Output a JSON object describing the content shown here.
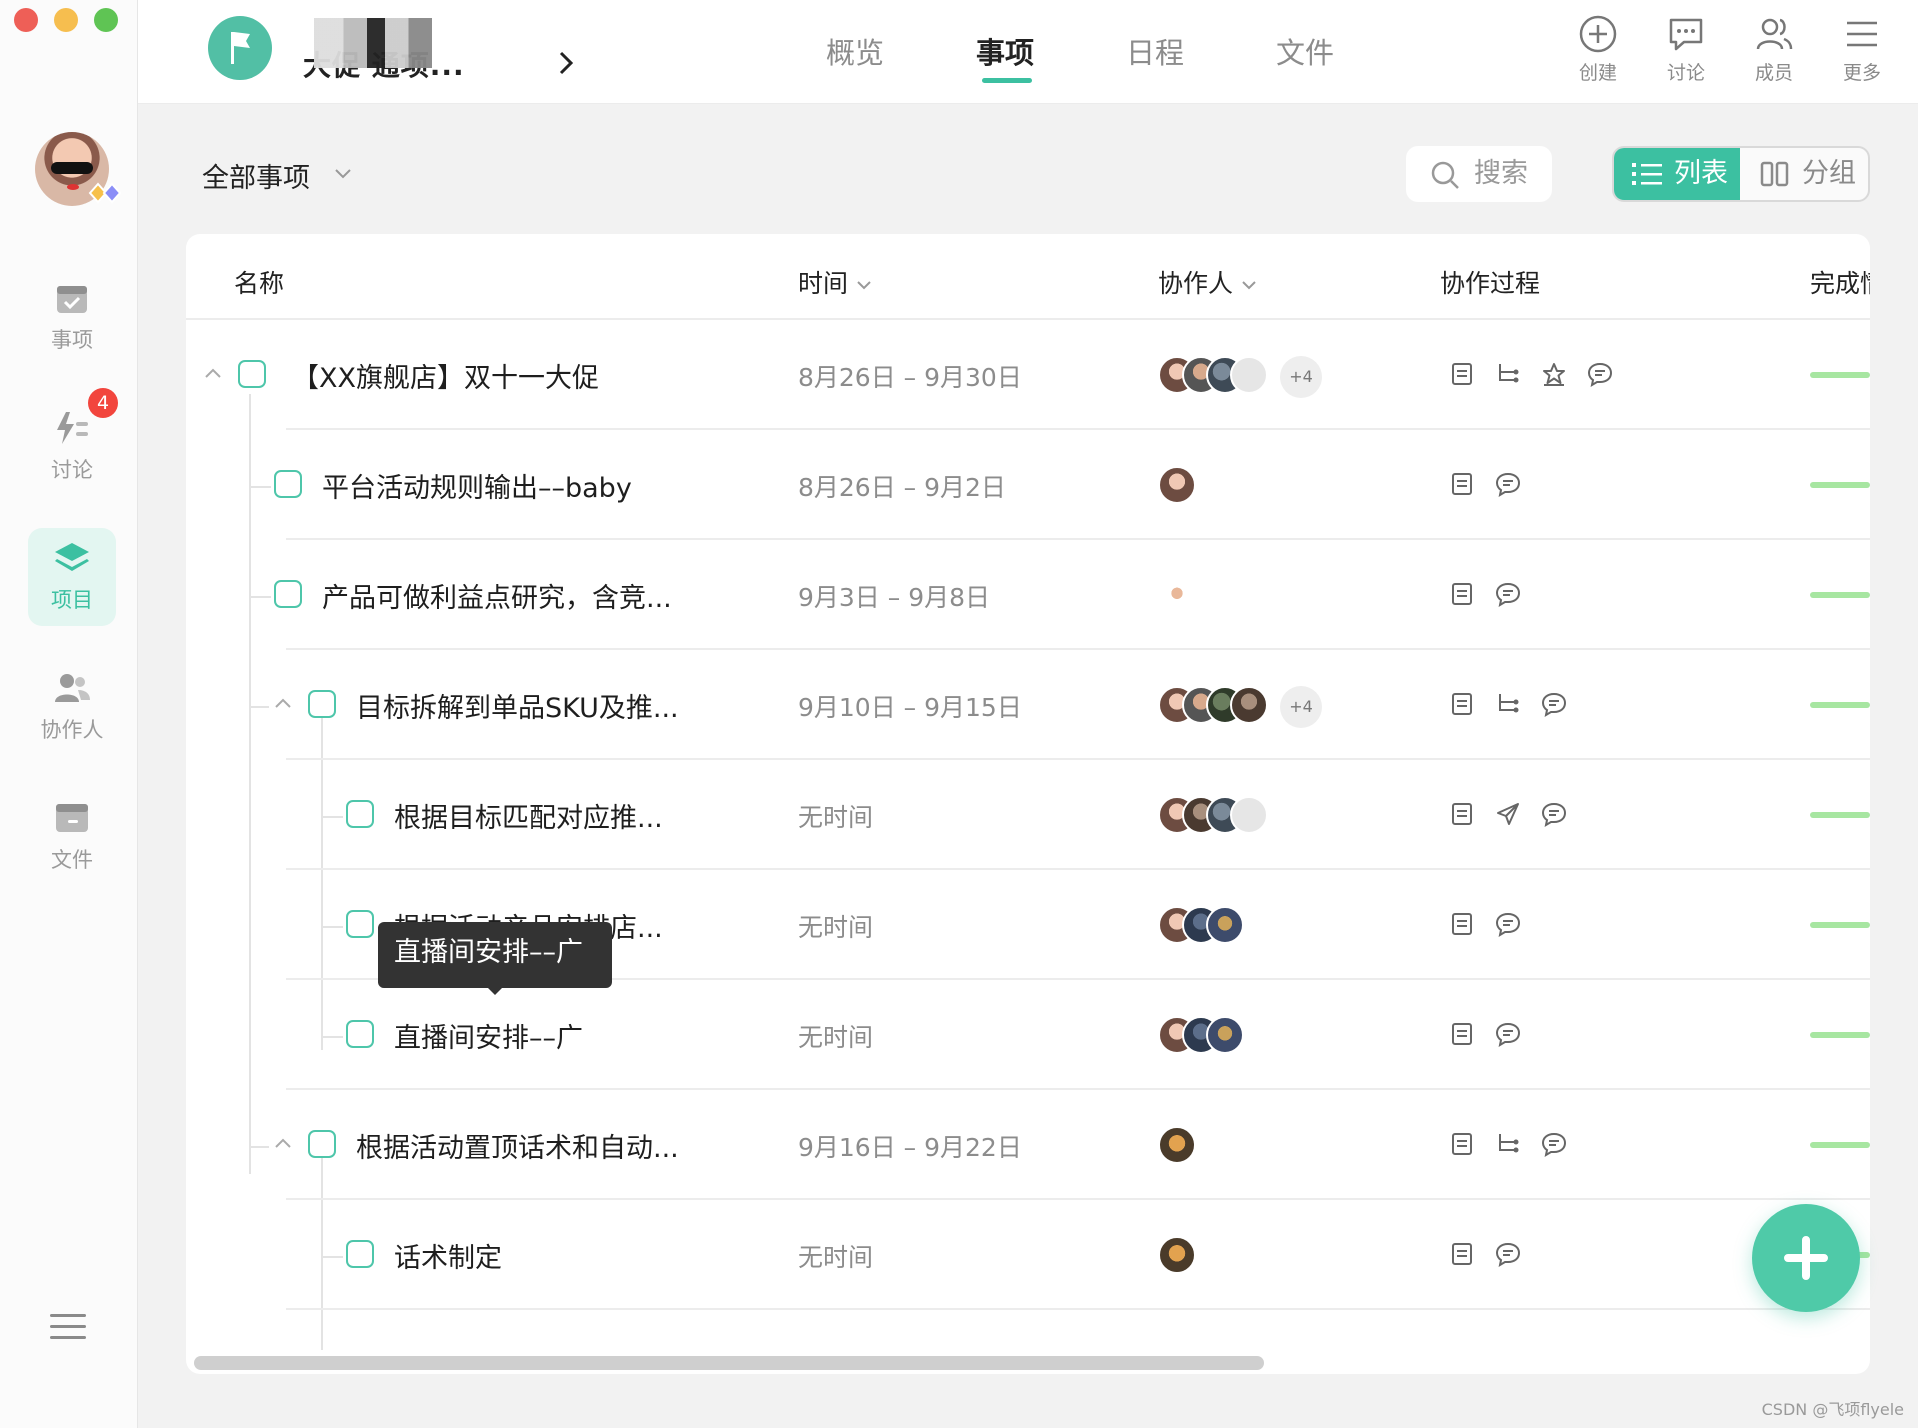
{
  "sidebar": {
    "items": [
      {
        "label": "事项",
        "icon": "calendar-check-icon"
      },
      {
        "label": "讨论",
        "icon": "lightning-list-icon",
        "badge": "4"
      },
      {
        "label": "项目",
        "icon": "layers-icon",
        "active": true
      },
      {
        "label": "协作人",
        "icon": "people-icon"
      },
      {
        "label": "文件",
        "icon": "folder-icon"
      }
    ]
  },
  "header": {
    "project_title": "大促 通项...",
    "tabs": [
      {
        "label": "概览"
      },
      {
        "label": "事项",
        "active": true
      },
      {
        "label": "日程"
      },
      {
        "label": "文件"
      }
    ],
    "tools": [
      {
        "label": "创建",
        "icon": "plus-circle-icon"
      },
      {
        "label": "讨论",
        "icon": "chat-bubble-icon"
      },
      {
        "label": "成员",
        "icon": "members-icon"
      },
      {
        "label": "更多",
        "icon": "menu-icon"
      }
    ]
  },
  "toolbar": {
    "filter": "全部事项",
    "search_label": "搜索",
    "view_list": "列表",
    "view_group": "分组"
  },
  "table": {
    "columns": {
      "name": "名称",
      "time": "时间",
      "assignees": "协作人",
      "process": "协作过程",
      "done": "完成情况"
    },
    "rows": [
      {
        "name": "【XX旗舰店】双十一大促",
        "time": "8月26日 – 9月30日",
        "extra": "+4",
        "icons": [
          "doc",
          "subtask",
          "star",
          "comment"
        ]
      },
      {
        "name": "平台活动规则输出––baby",
        "time": "8月26日 – 9月2日",
        "icons": [
          "doc",
          "comment"
        ]
      },
      {
        "name": "产品可做利益点研究，含竞...",
        "time": "9月3日 – 9月8日",
        "icons": [
          "doc",
          "comment"
        ]
      },
      {
        "name": "目标拆解到单品SKU及推...",
        "time": "9月10日 – 9月15日",
        "extra": "+4",
        "icons": [
          "doc",
          "subtask",
          "comment"
        ]
      },
      {
        "name": "根据目标匹配对应推...",
        "time": "无时间",
        "icons": [
          "doc",
          "send",
          "comment"
        ]
      },
      {
        "name": "根据活动产品安排店...",
        "time": "无时间",
        "icons": [
          "doc",
          "comment"
        ]
      },
      {
        "name": "直播间安排––广",
        "time": "无时间",
        "icons": [
          "doc",
          "comment"
        ]
      },
      {
        "name": "根据活动置顶话术和自动...",
        "time": "9月16日 – 9月22日",
        "icons": [
          "doc",
          "subtask",
          "comment"
        ]
      },
      {
        "name": "话术制定",
        "time": "无时间",
        "icons": [
          "doc",
          "comment"
        ]
      }
    ]
  },
  "tooltip": "直播间安排––广",
  "watermark": "CSDN @飞项flyele",
  "colors": {
    "accent": "#3cc0a1",
    "badge": "#f2453d",
    "progress": "#a7e6a1"
  }
}
